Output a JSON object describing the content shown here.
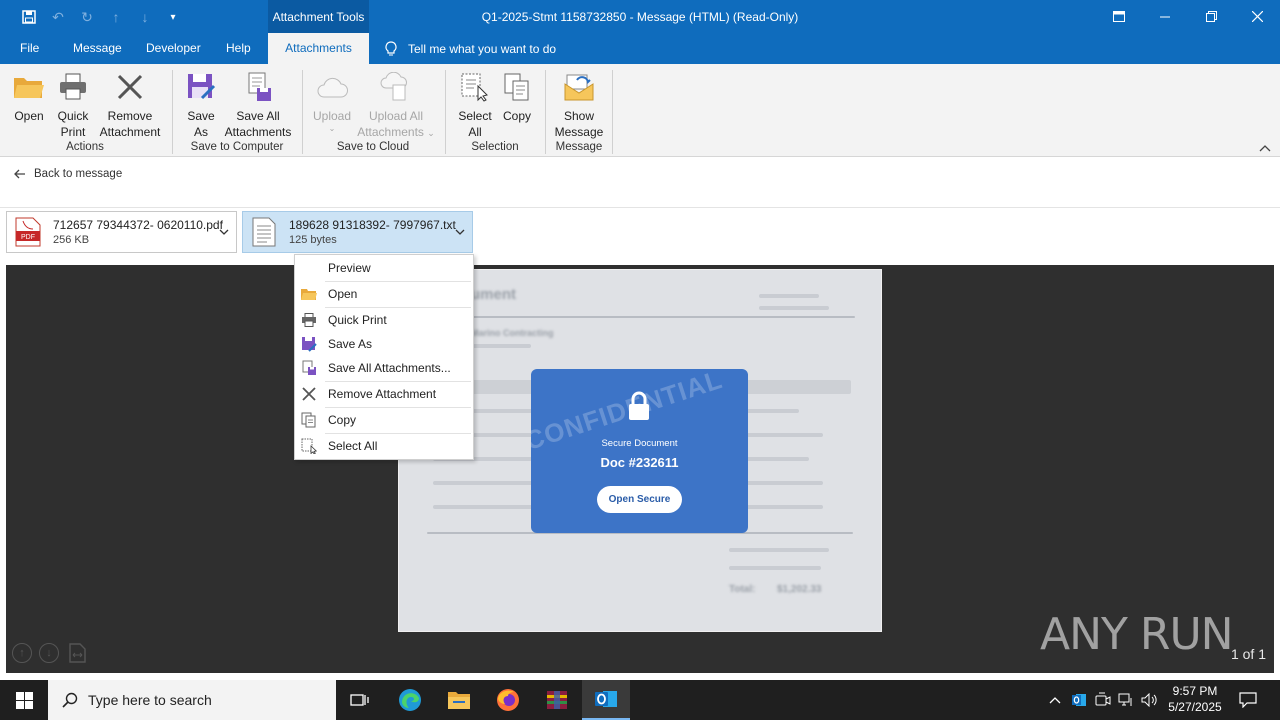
{
  "window": {
    "context_tab_title": "Attachment Tools",
    "title": "Q1-2025-Stmt 1158732850  -  Message (HTML) (Read-Only)"
  },
  "tabs": [
    {
      "label": "File"
    },
    {
      "label": "Message"
    },
    {
      "label": "Developer"
    },
    {
      "label": "Help"
    },
    {
      "label": "Attachments"
    }
  ],
  "tell_me": "Tell me what you want to do",
  "ribbon": {
    "open": "Open",
    "quick_print_1": "Quick",
    "quick_print_2": "Print",
    "remove_1": "Remove",
    "remove_2": "Attachment",
    "group_actions": "Actions",
    "save_as_1": "Save",
    "save_as_2": "As",
    "save_all_1": "Save All",
    "save_all_2": "Attachments",
    "group_save_computer": "Save to Computer",
    "upload": "Upload",
    "upload_all_1": "Upload All",
    "upload_all_2": "Attachments",
    "group_save_cloud": "Save to Cloud",
    "select_all_1": "Select",
    "select_all_2": "All",
    "copy": "Copy",
    "group_selection": "Selection",
    "show_message_1": "Show",
    "show_message_2": "Message",
    "group_message": "Message"
  },
  "back_to_message": "Back to message",
  "attachments": [
    {
      "name": "712657 79344372- 0620110.pdf",
      "size": "256 KB",
      "icon": "pdf-icon"
    },
    {
      "name": "189628 91318392- 7997967.txt",
      "size": "125 bytes",
      "icon": "text-file-icon"
    }
  ],
  "context_menu": [
    {
      "label": "Preview",
      "icon": "none"
    },
    {
      "label": "Open",
      "icon": "folder-icon"
    },
    {
      "label": "Quick Print",
      "icon": "printer-icon"
    },
    {
      "label": "Save As",
      "icon": "save-as-icon"
    },
    {
      "label": "Save All Attachments...",
      "icon": "save-all-icon"
    },
    {
      "label": "Remove Attachment",
      "icon": "remove-icon"
    },
    {
      "label": "Copy",
      "icon": "copy-icon"
    },
    {
      "label": "Select All",
      "icon": "select-all-icon"
    }
  ],
  "preview_doc": {
    "watermark": "CONFIDENTIAL",
    "secure_label": "Secure Document",
    "doc_number": "Doc #232611",
    "open_button": "Open Secure",
    "blur_title": "ument",
    "blur_company": "Marino Contracting",
    "blur_total_label": "Total:",
    "blur_total_value": "$1,202.33"
  },
  "page_count": "1 of 1",
  "watermark_brand": "ANY RUN",
  "taskbar": {
    "search_placeholder": "Type here to search",
    "time": "9:57 PM",
    "date": "5/27/2025"
  },
  "colors": {
    "accent": "#0f6cbd",
    "selected_chip": "#cce3f5",
    "secure_card": "#3d74c7"
  }
}
